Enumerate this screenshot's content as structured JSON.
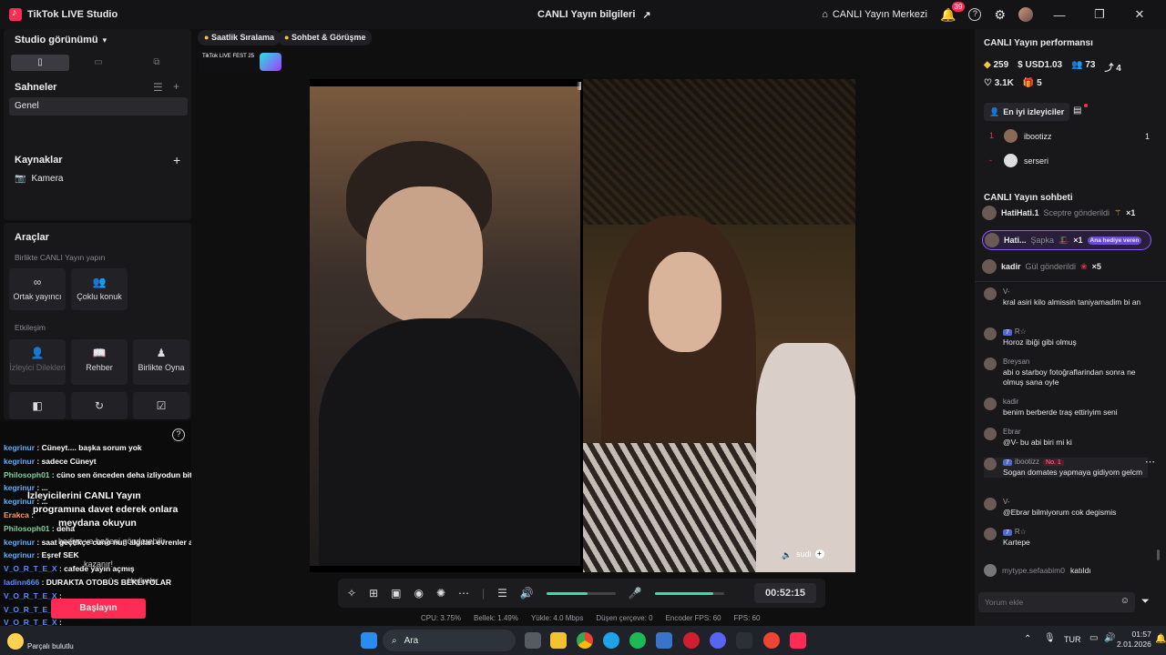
{
  "titlebar": {
    "app_name": "TikTok LIVE Studio",
    "center_title": "CANLI Yayın bilgileri",
    "live_center": "CANLI Yayın Merkezi",
    "notif_count": "39"
  },
  "left": {
    "studio_view": "Studio görünümü",
    "scenes_title": "Sahneler",
    "scene_item": "Genel",
    "sources_title": "Kaynaklar",
    "source_item": "Kamera",
    "tools_title": "Araçlar",
    "collab_title": "Birlikte CANLI Yayın yapın",
    "cohost": "Ortak yayıncı",
    "multi_guest": "Çoklu konuk",
    "interaction_title": "Etkileşim",
    "viewer_requests": "İzleyici Dilekleri",
    "guide": "Rehber",
    "play_together": "Birlikte Oyna"
  },
  "minichat": {
    "lines": [
      {
        "user": "kegrinur",
        "text": "Cüneyt.... başka sorum yok",
        "color": "#5fb0ff"
      },
      {
        "user": "kegrinur",
        "text": "sadece Cüneyt",
        "color": "#5fb0ff"
      },
      {
        "user": "Philosoph01",
        "text": "cüno sen önceden deha izliyodun bitti mi dizi",
        "color": "#7ad0a0"
      },
      {
        "user": "kegrinur",
        "text": "...",
        "color": "#5fb0ff"
      },
      {
        "user": "kegrinur",
        "text": "...",
        "color": "#5fb0ff"
      },
      {
        "user": "Erakca",
        "text": "",
        "color": "#ff9b5a"
      },
      {
        "user": "Philosoph01",
        "text": "deha",
        "color": "#7ad0a0"
      },
      {
        "user": "kegrinur",
        "text": "saat geçtikçe cuno nun algıları evrenler arası geçiş yapiyo",
        "color": "#5fb0ff"
      },
      {
        "user": "kegrinur",
        "text": "Eşref SEK",
        "color": "#5fb0ff"
      },
      {
        "user": "V_O_R_T_E_X",
        "text": "cafede yayın açmış",
        "color": "#5a8cff"
      },
      {
        "user": "ladinn666",
        "text": "DURAKTA OTOBÜS BEKLIYOLAR",
        "color": "#5a8cff"
      },
      {
        "user": "V_O_R_T_E_X",
        "text": "",
        "color": "#5a8cff"
      },
      {
        "user": "V_O_R_T_E_X",
        "text": "",
        "color": "#5a8cff"
      },
      {
        "user": "V_O_R_T_E_X",
        "text": "",
        "color": "#5a8cff"
      }
    ],
    "overlay_1": "İzleyicilerini CANLI Yayın",
    "overlay_2": "programına davet ederek onlara",
    "overlay_3": "meydana okuyun",
    "overlay_4": "hediye ve beğeni gönderebilir.",
    "overlay_5": "kazanır!",
    "overlay_6": "Hediyeler",
    "start_button": "Başlayın",
    "weather": "Parçalı bulutlu"
  },
  "center": {
    "pill_ranking": "Saatlik Sıralama",
    "pill_chat": "Sohbet & Görüşme",
    "livefest": "TikTok LIVE FEST 25",
    "guest_name": "sudi",
    "timer": "00:52:15",
    "stats": {
      "cpu": "CPU: 3.75%",
      "memory": "Bellek: 1.49%",
      "upload": "Yükle: 4.0 Mbps",
      "dropped": "Düşen çerçeve: 0",
      "encoder_fps": "Encoder FPS: 60",
      "fps": "FPS: 60"
    },
    "mic_volume": 0.85,
    "speaker_volume": 0.6
  },
  "right": {
    "perf_title": "CANLI Yayın performansı",
    "diamonds": "259",
    "usd": "USD1.03",
    "viewers": "73",
    "shares": "4",
    "likes": "3.1K",
    "gifts": "5",
    "top_viewers": "En iyi izleyiciler",
    "top": [
      {
        "rank": "1",
        "name": "ibootizz",
        "score": "1"
      },
      {
        "rank": "-",
        "name": "serseri",
        "score": ""
      }
    ],
    "chat_title": "CANLI Yayın sohbeti",
    "gift_events": [
      {
        "name": "HatiHati.1",
        "action": "Sceptre gönderildi",
        "count": "×1"
      },
      {
        "name": "Hati...",
        "action": "Şapka",
        "count": "×1",
        "badge": "Ana hediye veren"
      },
      {
        "name": "kadir",
        "action": "Gül gönderildi",
        "count": "×5"
      }
    ],
    "messages": [
      {
        "user": "V-",
        "text": "kral asiri kilo almissin taniyamadim bi an"
      },
      {
        "user": "R☆",
        "level": "7",
        "text": "Horoz ibiği gibi olmuş"
      },
      {
        "user": "Breysan",
        "text": "abi o starboy fotoğraflarindan sonra ne olmuş sana oyle"
      },
      {
        "user": "kadir",
        "text": "benim berberde traş ettiriyim seni"
      },
      {
        "user": "Ebrar",
        "text": "@V- bu abi biri mi ki"
      },
      {
        "user": "ibootizz",
        "level": "7",
        "rank": "No. 1",
        "text": "Sogan domates yapmaya gidiyom gelcm"
      },
      {
        "user": "V-",
        "text": "@Ebrar bilmiyorum cok degismis"
      },
      {
        "user": "R☆",
        "level": "7",
        "text": "Kartepe"
      }
    ],
    "join_user": "mytype.sefaabim0",
    "join_text": "katıldı",
    "comment_placeholder": "Yorum ekle"
  },
  "taskbar": {
    "search": "Ara",
    "lang": "TUR",
    "time": "01:57",
    "date": "2.01.2026"
  }
}
